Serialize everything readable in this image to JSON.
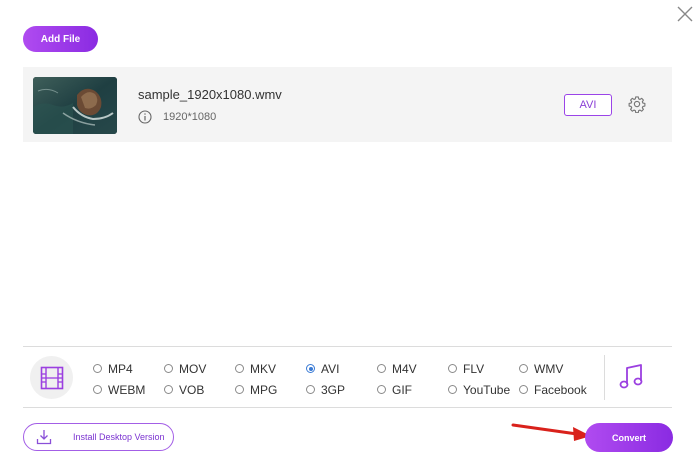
{
  "toolbar": {
    "add_file_label": "Add File"
  },
  "file": {
    "name": "sample_1920x1080.wmv",
    "resolution": "1920*1080",
    "output_format": "AVI"
  },
  "formats": {
    "selected": "AVI",
    "options": [
      {
        "label": "MP4",
        "checked": false
      },
      {
        "label": "MOV",
        "checked": false
      },
      {
        "label": "MKV",
        "checked": false
      },
      {
        "label": "AVI",
        "checked": true
      },
      {
        "label": "M4V",
        "checked": false
      },
      {
        "label": "FLV",
        "checked": false
      },
      {
        "label": "WMV",
        "checked": false
      },
      {
        "label": "WEBM",
        "checked": false
      },
      {
        "label": "VOB",
        "checked": false
      },
      {
        "label": "MPG",
        "checked": false
      },
      {
        "label": "3GP",
        "checked": false
      },
      {
        "label": "GIF",
        "checked": false
      },
      {
        "label": "YouTube",
        "checked": false
      },
      {
        "label": "Facebook",
        "checked": false
      }
    ]
  },
  "footer": {
    "install_label": "Install Desktop Version",
    "convert_label": "Convert"
  },
  "colors": {
    "accent": "#8a2be2",
    "accent_light": "#b04bf0",
    "radio_selected": "#3a7bd5",
    "annotation_arrow": "#d9211b"
  },
  "icons": {
    "close": "close-icon",
    "info": "info-icon",
    "settings": "gear-icon",
    "video_tab": "film-icon",
    "audio_tab": "music-note-icon",
    "install": "download-icon",
    "annotation": "red-arrow-icon"
  }
}
